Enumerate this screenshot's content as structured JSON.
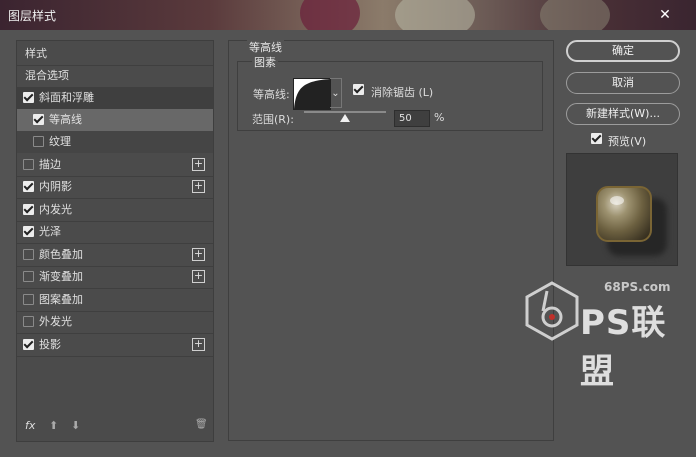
{
  "window": {
    "title": "图层样式",
    "close_glyph": "✕"
  },
  "left_panel": {
    "items": [
      {
        "label": "样式",
        "checked": null
      },
      {
        "label": "混合选项",
        "checked": null
      },
      {
        "label": "斜面和浮雕",
        "checked": true
      },
      {
        "label": "等高线",
        "checked": true
      },
      {
        "label": "纹理",
        "checked": false
      },
      {
        "label": "描边",
        "checked": false,
        "plus": "+"
      },
      {
        "label": "内阴影",
        "checked": true,
        "plus": "+"
      },
      {
        "label": "内发光",
        "checked": true
      },
      {
        "label": "光泽",
        "checked": true
      },
      {
        "label": "颜色叠加",
        "checked": false,
        "plus": "+"
      },
      {
        "label": "渐变叠加",
        "checked": false,
        "plus": "+"
      },
      {
        "label": "图案叠加",
        "checked": false
      },
      {
        "label": "外发光",
        "checked": false
      },
      {
        "label": "投影",
        "checked": true,
        "plus": "+"
      }
    ],
    "bottom": {
      "fx": "fx",
      "up_glyph": "⬆",
      "down_glyph": "⬇",
      "trash_glyph": "🗑"
    }
  },
  "center": {
    "group_title": "等高线",
    "sub_title": "图素",
    "contour_label": "等高线:",
    "antialias_label": "消除锯齿 (L)",
    "antialias_checked": true,
    "range_label": "范围(R):",
    "range_value": "50",
    "range_unit": "%",
    "range_fraction": 0.5,
    "dropdown_glyph": "⌄"
  },
  "right": {
    "ok_label": "确定",
    "cancel_label": "取消",
    "new_style_label": "新建样式(W)...",
    "preview_label": "预览(V)",
    "preview_checked": true
  },
  "watermark": {
    "site": "68PS.com",
    "brand": "PS联盟"
  }
}
